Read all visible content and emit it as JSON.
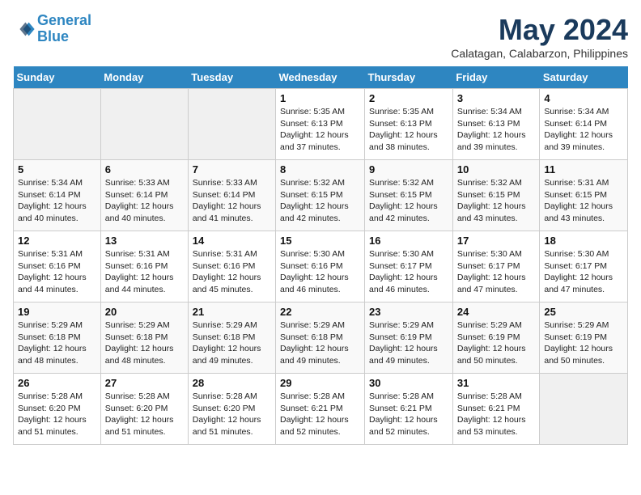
{
  "header": {
    "logo_line1": "General",
    "logo_line2": "Blue",
    "month_title": "May 2024",
    "subtitle": "Calatagan, Calabarzon, Philippines"
  },
  "days_of_week": [
    "Sunday",
    "Monday",
    "Tuesday",
    "Wednesday",
    "Thursday",
    "Friday",
    "Saturday"
  ],
  "weeks": [
    [
      {
        "day": "",
        "info": ""
      },
      {
        "day": "",
        "info": ""
      },
      {
        "day": "",
        "info": ""
      },
      {
        "day": "1",
        "info": "Sunrise: 5:35 AM\nSunset: 6:13 PM\nDaylight: 12 hours\nand 37 minutes."
      },
      {
        "day": "2",
        "info": "Sunrise: 5:35 AM\nSunset: 6:13 PM\nDaylight: 12 hours\nand 38 minutes."
      },
      {
        "day": "3",
        "info": "Sunrise: 5:34 AM\nSunset: 6:13 PM\nDaylight: 12 hours\nand 39 minutes."
      },
      {
        "day": "4",
        "info": "Sunrise: 5:34 AM\nSunset: 6:14 PM\nDaylight: 12 hours\nand 39 minutes."
      }
    ],
    [
      {
        "day": "5",
        "info": "Sunrise: 5:34 AM\nSunset: 6:14 PM\nDaylight: 12 hours\nand 40 minutes."
      },
      {
        "day": "6",
        "info": "Sunrise: 5:33 AM\nSunset: 6:14 PM\nDaylight: 12 hours\nand 40 minutes."
      },
      {
        "day": "7",
        "info": "Sunrise: 5:33 AM\nSunset: 6:14 PM\nDaylight: 12 hours\nand 41 minutes."
      },
      {
        "day": "8",
        "info": "Sunrise: 5:32 AM\nSunset: 6:15 PM\nDaylight: 12 hours\nand 42 minutes."
      },
      {
        "day": "9",
        "info": "Sunrise: 5:32 AM\nSunset: 6:15 PM\nDaylight: 12 hours\nand 42 minutes."
      },
      {
        "day": "10",
        "info": "Sunrise: 5:32 AM\nSunset: 6:15 PM\nDaylight: 12 hours\nand 43 minutes."
      },
      {
        "day": "11",
        "info": "Sunrise: 5:31 AM\nSunset: 6:15 PM\nDaylight: 12 hours\nand 43 minutes."
      }
    ],
    [
      {
        "day": "12",
        "info": "Sunrise: 5:31 AM\nSunset: 6:16 PM\nDaylight: 12 hours\nand 44 minutes."
      },
      {
        "day": "13",
        "info": "Sunrise: 5:31 AM\nSunset: 6:16 PM\nDaylight: 12 hours\nand 44 minutes."
      },
      {
        "day": "14",
        "info": "Sunrise: 5:31 AM\nSunset: 6:16 PM\nDaylight: 12 hours\nand 45 minutes."
      },
      {
        "day": "15",
        "info": "Sunrise: 5:30 AM\nSunset: 6:16 PM\nDaylight: 12 hours\nand 46 minutes."
      },
      {
        "day": "16",
        "info": "Sunrise: 5:30 AM\nSunset: 6:17 PM\nDaylight: 12 hours\nand 46 minutes."
      },
      {
        "day": "17",
        "info": "Sunrise: 5:30 AM\nSunset: 6:17 PM\nDaylight: 12 hours\nand 47 minutes."
      },
      {
        "day": "18",
        "info": "Sunrise: 5:30 AM\nSunset: 6:17 PM\nDaylight: 12 hours\nand 47 minutes."
      }
    ],
    [
      {
        "day": "19",
        "info": "Sunrise: 5:29 AM\nSunset: 6:18 PM\nDaylight: 12 hours\nand 48 minutes."
      },
      {
        "day": "20",
        "info": "Sunrise: 5:29 AM\nSunset: 6:18 PM\nDaylight: 12 hours\nand 48 minutes."
      },
      {
        "day": "21",
        "info": "Sunrise: 5:29 AM\nSunset: 6:18 PM\nDaylight: 12 hours\nand 49 minutes."
      },
      {
        "day": "22",
        "info": "Sunrise: 5:29 AM\nSunset: 6:18 PM\nDaylight: 12 hours\nand 49 minutes."
      },
      {
        "day": "23",
        "info": "Sunrise: 5:29 AM\nSunset: 6:19 PM\nDaylight: 12 hours\nand 49 minutes."
      },
      {
        "day": "24",
        "info": "Sunrise: 5:29 AM\nSunset: 6:19 PM\nDaylight: 12 hours\nand 50 minutes."
      },
      {
        "day": "25",
        "info": "Sunrise: 5:29 AM\nSunset: 6:19 PM\nDaylight: 12 hours\nand 50 minutes."
      }
    ],
    [
      {
        "day": "26",
        "info": "Sunrise: 5:28 AM\nSunset: 6:20 PM\nDaylight: 12 hours\nand 51 minutes."
      },
      {
        "day": "27",
        "info": "Sunrise: 5:28 AM\nSunset: 6:20 PM\nDaylight: 12 hours\nand 51 minutes."
      },
      {
        "day": "28",
        "info": "Sunrise: 5:28 AM\nSunset: 6:20 PM\nDaylight: 12 hours\nand 51 minutes."
      },
      {
        "day": "29",
        "info": "Sunrise: 5:28 AM\nSunset: 6:21 PM\nDaylight: 12 hours\nand 52 minutes."
      },
      {
        "day": "30",
        "info": "Sunrise: 5:28 AM\nSunset: 6:21 PM\nDaylight: 12 hours\nand 52 minutes."
      },
      {
        "day": "31",
        "info": "Sunrise: 5:28 AM\nSunset: 6:21 PM\nDaylight: 12 hours\nand 53 minutes."
      },
      {
        "day": "",
        "info": ""
      }
    ]
  ]
}
